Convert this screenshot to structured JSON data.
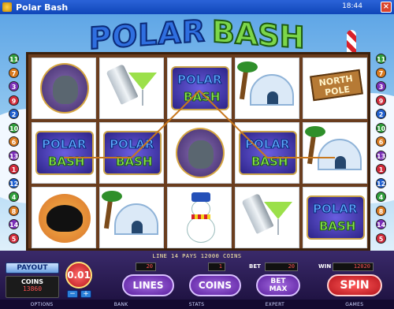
{
  "window": {
    "title": "Polar Bash",
    "clock": "18:44"
  },
  "game": {
    "logo_word1": "POLAR",
    "logo_word2": "BASH"
  },
  "symbols": {
    "logo_top": "POLAR",
    "logo_bottom": "BASH",
    "north_pole_line1": "NORTH",
    "north_pole_line2": "POLE"
  },
  "reels": [
    [
      "walrus-party",
      "polar-bash-logo",
      "orca"
    ],
    [
      "shaker-martini",
      "polar-bash-logo",
      "igloo-palm"
    ],
    [
      "polar-bash-logo",
      "walrus-party",
      "snowman"
    ],
    [
      "igloo-palm",
      "polar-bash-logo",
      "shaker-martini"
    ],
    [
      "north-pole-sign",
      "igloo-palm",
      "polar-bash-logo"
    ]
  ],
  "line_markers_left": [
    "11",
    "7",
    "3",
    "9",
    "2",
    "10",
    "6",
    "13",
    "1",
    "12",
    "4",
    "8",
    "14",
    "5"
  ],
  "line_markers_right": [
    "11",
    "7",
    "3",
    "9",
    "2",
    "10",
    "6",
    "13",
    "1",
    "12",
    "4",
    "8",
    "14",
    "5"
  ],
  "panel": {
    "payline_text": "LINE 14 PAYS 12000 COINS",
    "payout_label": "PAYOUT",
    "coins_label": "COINS",
    "coins_value": "13860",
    "coin_size": "0.01",
    "minus": "−",
    "plus": "+",
    "lines_value": "20",
    "coins_per_line_value": "1",
    "bet_label": "BET",
    "bet_value": "20",
    "win_label": "WIN",
    "win_value": "12020",
    "lines_button": "LINES",
    "coins_button": "COINS",
    "betmax_line1": "BET",
    "betmax_line2": "MAX",
    "spin_button": "SPIN"
  },
  "menu": [
    "OPTIONS",
    "BANK",
    "STATS",
    "EXPERT",
    "GAMES"
  ],
  "colors": {
    "marker_palette": [
      "#2f9e3a",
      "#d97a1f",
      "#7b2fb8",
      "#d12b3a",
      "#1f5fcf"
    ]
  }
}
